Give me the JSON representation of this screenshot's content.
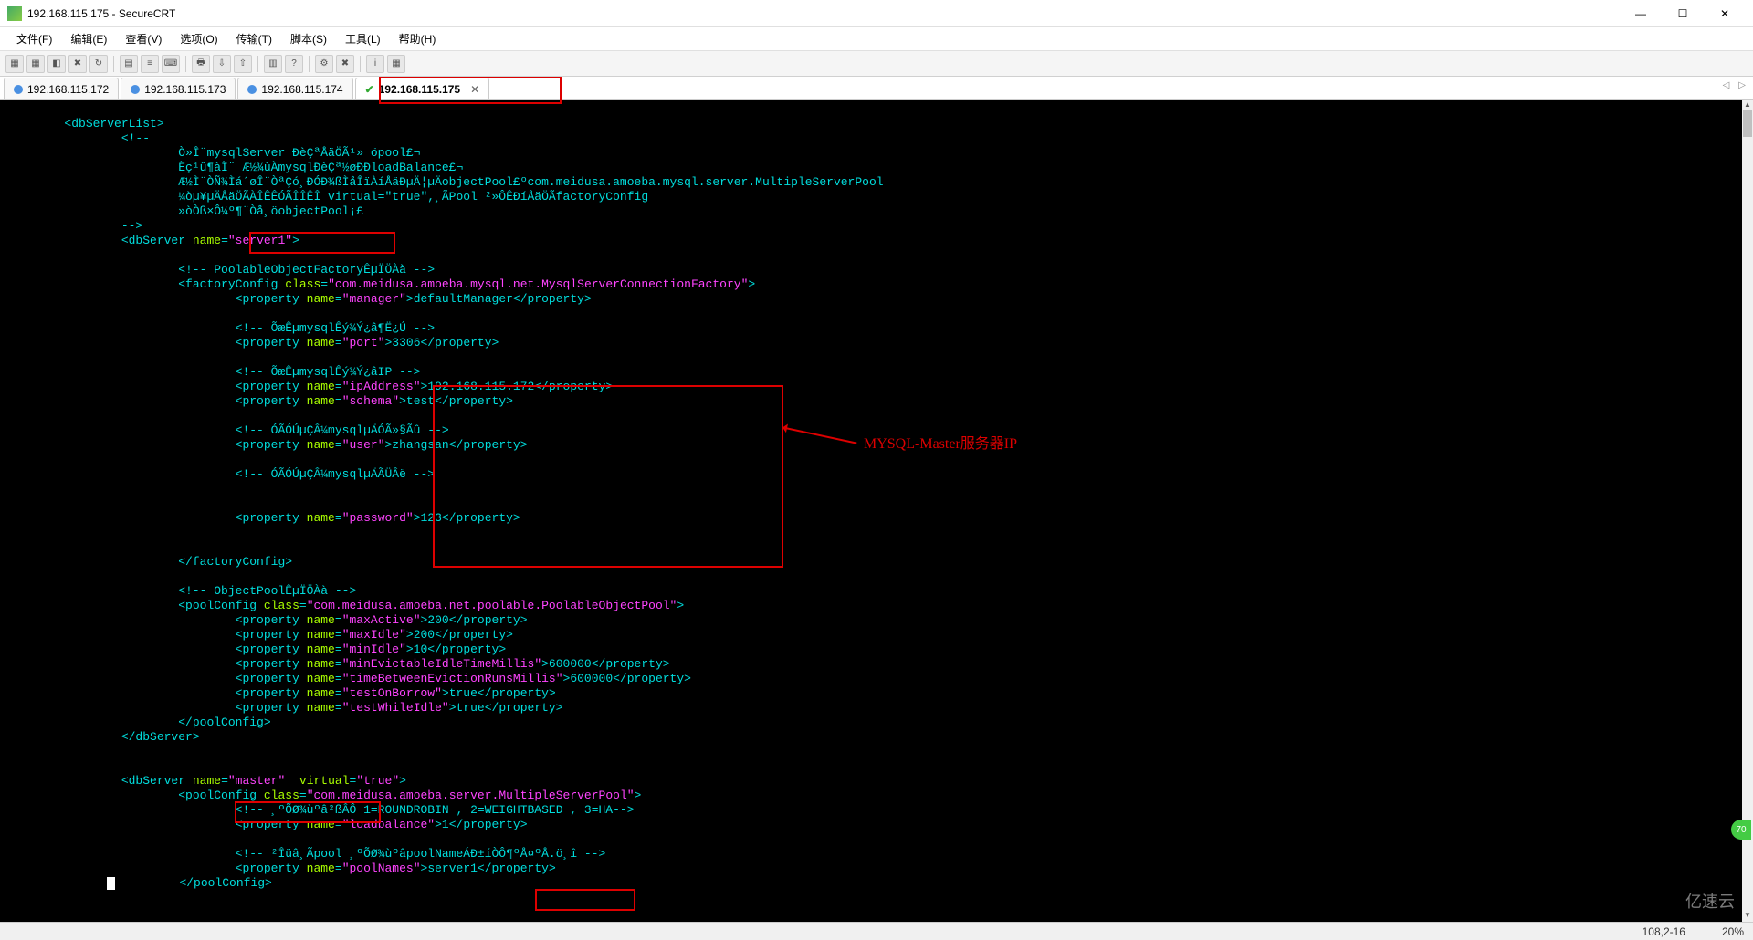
{
  "window": {
    "title": "192.168.115.175 - SecureCRT",
    "btn_min": "—",
    "btn_max": "☐",
    "btn_close": "✕"
  },
  "menu": {
    "file": "文件(F)",
    "edit": "编辑(E)",
    "view": "查看(V)",
    "options": "选项(O)",
    "transfer": "传输(T)",
    "script": "脚本(S)",
    "tools": "工具(L)",
    "help": "帮助(H)"
  },
  "tabs": {
    "t1": "192.168.115.172",
    "t2": "192.168.115.173",
    "t3": "192.168.115.174",
    "t4": "192.168.115.175",
    "close_x": "✕",
    "check": "✔",
    "scroll_left": "◁",
    "scroll_right": "▷"
  },
  "annotation": {
    "master_ip": "MYSQL-Master服务器IP"
  },
  "status": {
    "pos": "108,2-16",
    "pct": "20%"
  },
  "watermark": "亿速云",
  "badge": "70",
  "code": {
    "l1a": "<dbServerList>",
    "l2a": "<!--",
    "l3a": "Ò»Î¨mysqlServer ÐèÇªÅäÖÃ¹» öpool£¬",
    "l4a": "Èç¹û¶àÌ¨ Æ½¾ùÀmysqlÐèÇª½øÐÐloadBalance£¬",
    "l5a": "Æ½Ì¨ÒÑ¾Ìá´øÎ¨ÒªÇó¸ÐÓÐ¾ßÌåÎïÀíÅäÐµÄ¦µÄobjectPool£ºcom.meidusa.amoeba.mysql.server.MultipleServerPool",
    "l6a": "¼òµ¥µÄÅäÖÃÀÎÊÊÓÃÎÎÊÎ virtual=\"true\",¸ÃPool ²»ÔÊÐíÅäÖÃfactoryConfig",
    "l7a": "»òÒß×Ô¼º¶¨Òå¸öobjectPool¡£",
    "l8a": "-->",
    "l9a": "<dbServer ",
    "l9b": "name",
    "l9c": "=",
    "l9d": "\"server1\"",
    "l9e": ">",
    "l11a": "<!-- PoolableObjectFactoryÊµÏÖÀà -->",
    "l12a": "<factoryConfig ",
    "l12b": "class",
    "l12c": "=",
    "l12d": "\"com.meidusa.amoeba.mysql.net.MysqlServerConnectionFactory\"",
    "l12e": ">",
    "l13a": "<property ",
    "l13b": "name",
    "l13c": "=",
    "l13d": "\"manager\"",
    "l13e": ">defaultManager</property>",
    "l15a": "<!-- ÕæÊµmysqlÊý¾Ý¿â¶Ë¿Ú -->",
    "l16a": "<property ",
    "l16b": "name",
    "l16c": "=",
    "l16d": "\"port\"",
    "l16e": ">3306</property>",
    "l18a": "<!-- ÕæÊµmysqlÊý¾Ý¿âIP -->",
    "l19a": "<property ",
    "l19b": "name",
    "l19c": "=",
    "l19d": "\"ipAddress\"",
    "l19e": ">192.168.115.172</property>",
    "l20a": "<property ",
    "l20b": "name",
    "l20c": "=",
    "l20d": "\"schema\"",
    "l20e": ">test</property>",
    "l22a": "<!-- ÓÃÓÚµÇÂ¼mysqlµÄÓÃ»§Ãû -->",
    "l23a": "<property ",
    "l23b": "name",
    "l23c": "=",
    "l23d": "\"user\"",
    "l23e": ">zhangsan</property>",
    "l25a": "<!-- ÓÃÓÚµÇÂ¼mysqlµÄÃÜÂë -->",
    "l28a": "<property ",
    "l28b": "name",
    "l28c": "=",
    "l28d": "\"password\"",
    "l28e": ">123</property>",
    "l31a": "</factoryConfig>",
    "l33a": "<!-- ObjectPoolÊµÏÖÀà -->",
    "l34a": "<poolConfig ",
    "l34b": "class",
    "l34c": "=",
    "l34d": "\"com.meidusa.amoeba.net.poolable.PoolableObjectPool\"",
    "l34e": ">",
    "l35a": "<property ",
    "l35b": "name",
    "l35c": "=",
    "l35d": "\"maxActive\"",
    "l35e": ">200</property>",
    "l36a": "<property ",
    "l36b": "name",
    "l36c": "=",
    "l36d": "\"maxIdle\"",
    "l36e": ">200</property>",
    "l37a": "<property ",
    "l37b": "name",
    "l37c": "=",
    "l37d": "\"minIdle\"",
    "l37e": ">10</property>",
    "l38a": "<property ",
    "l38b": "name",
    "l38c": "=",
    "l38d": "\"minEvictableIdleTimeMillis\"",
    "l38e": ">600000</property>",
    "l39a": "<property ",
    "l39b": "name",
    "l39c": "=",
    "l39d": "\"timeBetweenEvictionRunsMillis\"",
    "l39e": ">600000</property>",
    "l40a": "<property ",
    "l40b": "name",
    "l40c": "=",
    "l40d": "\"testOnBorrow\"",
    "l40e": ">true</property>",
    "l41a": "<property ",
    "l41b": "name",
    "l41c": "=",
    "l41d": "\"testWhileIdle\"",
    "l41e": ">true</property>",
    "l42a": "</poolConfig>",
    "l43a": "</dbServer>",
    "l46a": "<dbServer ",
    "l46b": "name",
    "l46c": "=",
    "l46d": "\"master\"",
    "l46e": "  ",
    "l46f": "virtual",
    "l46g": "=",
    "l46h": "\"true\"",
    "l46i": ">",
    "l47a": "<poolConfig ",
    "l47b": "class",
    "l47c": "=",
    "l47d": "\"com.meidusa.amoeba.server.MultipleServerPool\"",
    "l47e": ">",
    "l48a": "<!-- ¸ºÕØ¾ùºâ²ßÂÔ 1=ROUNDROBIN , 2=WEIGHTBASED , 3=HA-->",
    "l49a": "<property ",
    "l49b": "name",
    "l49c": "=",
    "l49d": "\"loadbalance\"",
    "l49e": ">1</property>",
    "l51a": "<!-- ²Îüâ¸Ãpool ¸ºÕØ¾ùºâpoolNameÁÐ±íÒÔ¶ºÅ¤ºÅ.ö¸î -->",
    "l52a": "<property ",
    "l52b": "name",
    "l52c": "=",
    "l52d": "\"poolNames\"",
    "l52e": ">server1</property>",
    "l53a": "</poolConfig>"
  }
}
